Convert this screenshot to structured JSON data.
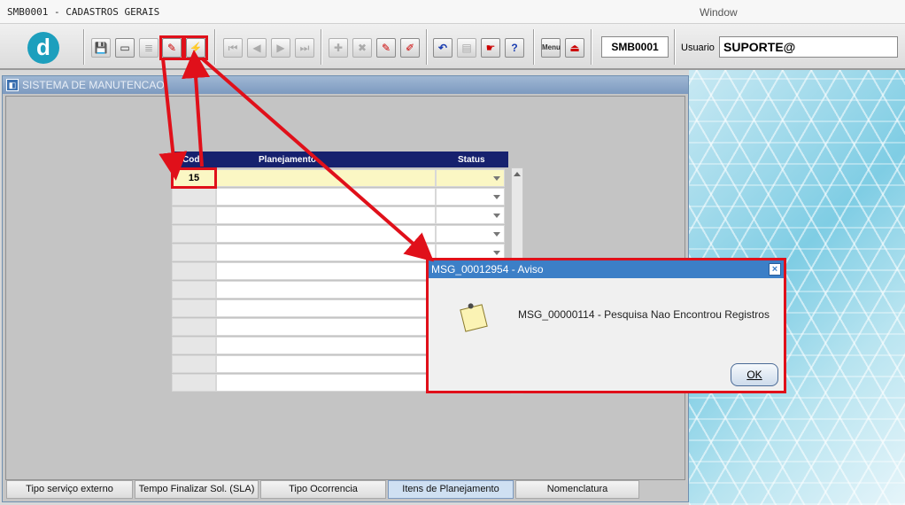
{
  "window": {
    "title": "SMB0001 - CADASTROS GERAIS",
    "menu_window": "Window"
  },
  "toolbar": {
    "logo_letter": "d",
    "module_code": "SMB0001",
    "user_label": "Usuario",
    "user_value": "SUPORTE@",
    "buttons": [
      {
        "name": "save-button",
        "glyph": "💾"
      },
      {
        "name": "print-preview-button",
        "glyph": "▭"
      },
      {
        "name": "print-button",
        "glyph": "≣"
      },
      {
        "name": "enter-query-button",
        "glyph": "✎"
      },
      {
        "name": "execute-query-button",
        "glyph": "⚡"
      },
      {
        "name": "first-record-button",
        "glyph": "⏮"
      },
      {
        "name": "previous-record-button",
        "glyph": "◀"
      },
      {
        "name": "next-record-button",
        "glyph": "▶"
      },
      {
        "name": "last-record-button",
        "glyph": "⏭"
      },
      {
        "name": "insert-record-button",
        "glyph": "✚"
      },
      {
        "name": "delete-record-button",
        "glyph": "✖"
      },
      {
        "name": "edit-record-button",
        "glyph": "✎"
      },
      {
        "name": "clear-record-button",
        "glyph": "✐"
      },
      {
        "name": "undo-button",
        "glyph": "↶"
      },
      {
        "name": "clipboard-button",
        "glyph": "▤"
      },
      {
        "name": "tools-button",
        "glyph": "☛"
      },
      {
        "name": "help-button",
        "glyph": "?"
      },
      {
        "name": "menu-button",
        "glyph": "Menu"
      },
      {
        "name": "exit-button",
        "glyph": "⏏"
      }
    ]
  },
  "main_window": {
    "title": "SISTEMA DE MANUTENCAO"
  },
  "grid": {
    "headers": {
      "cod": "Cod",
      "planejamento": "Planejamento",
      "status": "Status"
    },
    "rows": [
      {
        "cod": "15",
        "planejamento": "",
        "status": ""
      },
      {
        "cod": "",
        "planejamento": "",
        "status": ""
      },
      {
        "cod": "",
        "planejamento": "",
        "status": ""
      },
      {
        "cod": "",
        "planejamento": "",
        "status": ""
      },
      {
        "cod": "",
        "planejamento": "",
        "status": ""
      },
      {
        "cod": "",
        "planejamento": "",
        "status": ""
      },
      {
        "cod": "",
        "planejamento": "",
        "status": ""
      },
      {
        "cod": "",
        "planejamento": "",
        "status": ""
      },
      {
        "cod": "",
        "planejamento": "",
        "status": ""
      },
      {
        "cod": "",
        "planejamento": "",
        "status": ""
      },
      {
        "cod": "",
        "planejamento": "",
        "status": ""
      },
      {
        "cod": "",
        "planejamento": "",
        "status": ""
      }
    ]
  },
  "tabs": [
    {
      "label": "Tipo serviço externo",
      "active": false
    },
    {
      "label": "Tempo Finalizar Sol. (SLA)",
      "active": false
    },
    {
      "label": "Tipo Ocorrencia",
      "active": false
    },
    {
      "label": "Itens de Planejamento",
      "active": true
    },
    {
      "label": "Nomenclatura",
      "active": false
    }
  ],
  "dialog": {
    "title": "MSG_00012954 - Aviso",
    "close_glyph": "×",
    "message": "MSG_00000114 - Pesquisa Nao Encontrou Registros",
    "ok_label": "OK"
  },
  "colors": {
    "highlight": "#e0101a",
    "grid_header": "#16216e",
    "dialog_title": "#3c7fc7",
    "active_row": "#fbf7c4"
  }
}
